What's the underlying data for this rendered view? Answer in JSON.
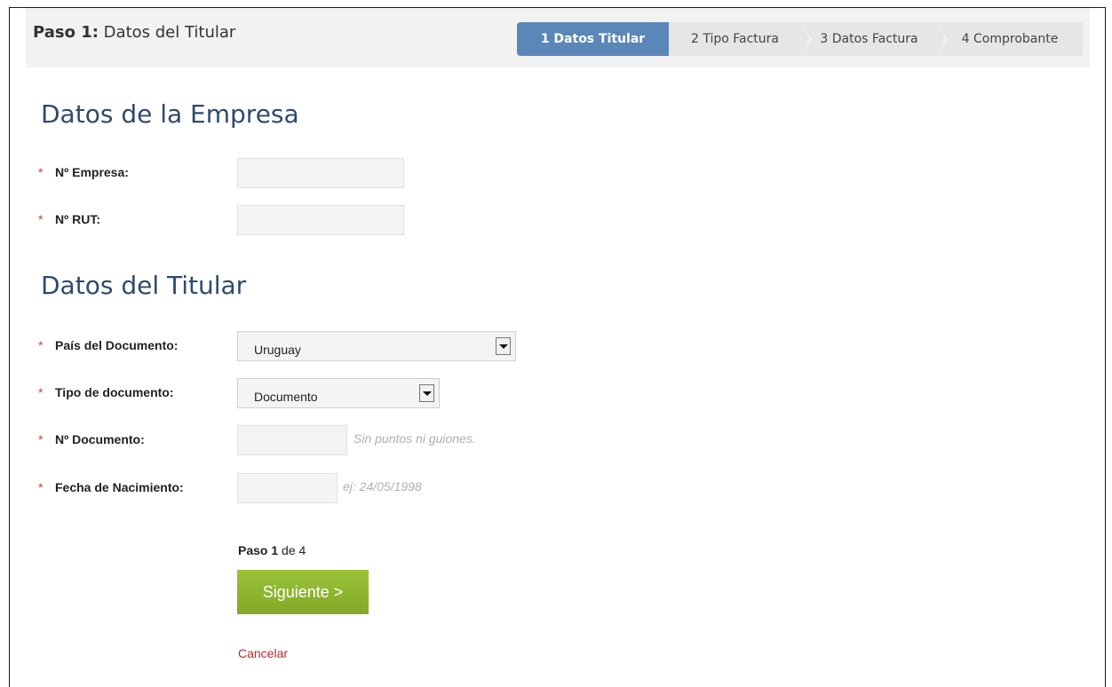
{
  "header": {
    "step_prefix": "Paso 1:",
    "step_title": "Datos del Titular"
  },
  "wizard": {
    "steps": [
      {
        "label": "1 Datos Titular",
        "active": true
      },
      {
        "label": "2 Tipo Factura",
        "active": false
      },
      {
        "label": "3 Datos Factura",
        "active": false
      },
      {
        "label": "4 Comprobante",
        "active": false
      }
    ]
  },
  "empresa": {
    "title": "Datos de la Empresa",
    "fields": {
      "numero_empresa": {
        "required": "*",
        "label": "Nº Empresa:",
        "value": ""
      },
      "numero_rut": {
        "required": "*",
        "label": "Nº RUT:",
        "value": ""
      }
    }
  },
  "titular": {
    "title": "Datos del Titular",
    "fields": {
      "pais": {
        "required": "*",
        "label": "País del Documento:",
        "value": "Uruguay"
      },
      "tipo_doc": {
        "required": "*",
        "label": "Tipo de documento:",
        "value": "Documento"
      },
      "numero_doc": {
        "required": "*",
        "label": "Nº Documento:",
        "value": "",
        "hint": "Sin puntos ni guiones."
      },
      "fecha_nac": {
        "required": "*",
        "label": "Fecha de Nacimiento:",
        "value": "",
        "hint": "ej: 24/05/1998"
      }
    }
  },
  "footer": {
    "paso_label": "Paso",
    "paso_current": "1",
    "paso_of": "de 4",
    "next_label": "Siguiente >",
    "cancel_label": "Cancelar"
  },
  "colors": {
    "wizard_active": "#5b87b8",
    "section_title": "#2e4a6e",
    "required_mark": "#d6402f",
    "next_button": "#8db52b",
    "cancel_link": "#c0262c"
  }
}
